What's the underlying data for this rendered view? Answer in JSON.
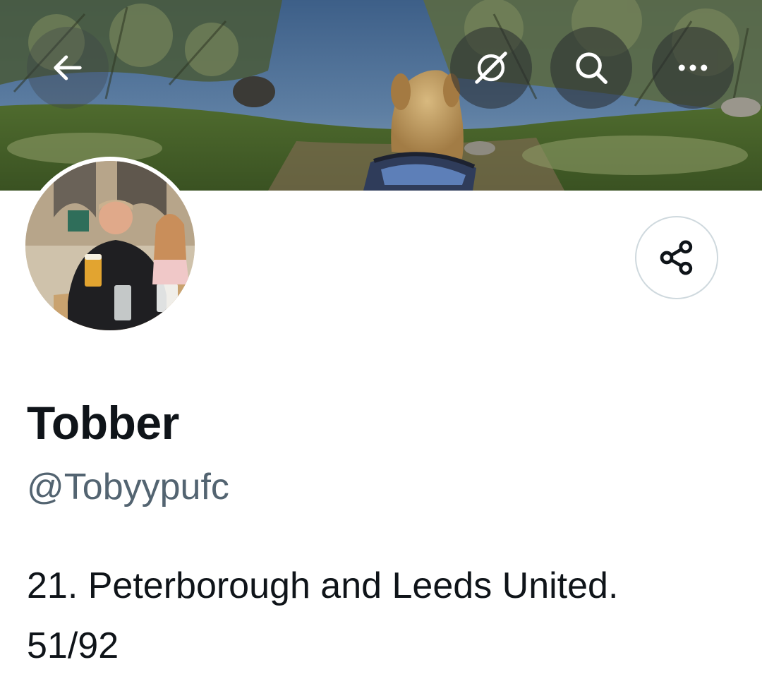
{
  "header": {
    "back_icon": "arrow-left-icon",
    "grok_icon": "grok-icon",
    "search_icon": "search-icon",
    "more_icon": "more-horizontal-icon"
  },
  "profile": {
    "display_name": "Tobber",
    "handle": "@Tobyypufc",
    "bio_line_1": "21. Peterborough and Leeds United.",
    "bio_line_2": "51/92",
    "share_icon": "share-icon"
  },
  "colors": {
    "text_primary": "#0f1419",
    "text_secondary": "#536471",
    "border": "#cfd9de"
  }
}
